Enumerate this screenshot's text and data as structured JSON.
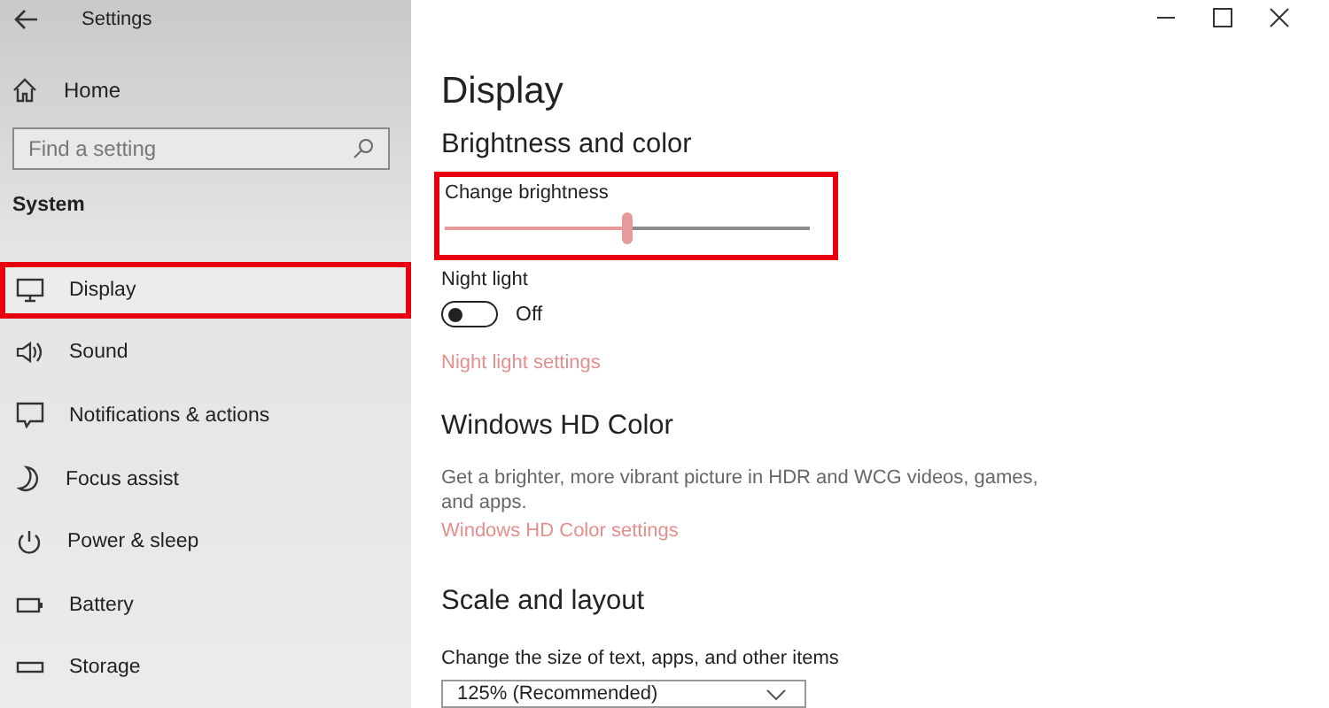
{
  "window": {
    "title": "Settings"
  },
  "sidebar": {
    "home": "Home",
    "search": {
      "placeholder": "Find a setting"
    },
    "section": "System",
    "items": [
      {
        "label": "Display",
        "highlighted": true
      },
      {
        "label": "Sound",
        "highlighted": false
      },
      {
        "label": "Notifications & actions",
        "highlighted": false
      },
      {
        "label": "Focus assist",
        "highlighted": false
      },
      {
        "label": "Power & sleep",
        "highlighted": false
      },
      {
        "label": "Battery",
        "highlighted": false
      },
      {
        "label": "Storage",
        "highlighted": false
      }
    ]
  },
  "page": {
    "title": "Display",
    "brightness_section": {
      "heading": "Brightness and color",
      "slider_label": "Change brightness",
      "level": 0.5,
      "highlighted": true
    },
    "night_light": {
      "label": "Night light",
      "on": false,
      "state_text": "Off",
      "link": "Night light settings"
    },
    "hd_color": {
      "heading": "Windows HD Color",
      "description": "Get a brighter, more vibrant picture in HDR and WCG videos, games, and apps.",
      "link": "Windows HD Color settings"
    },
    "scale": {
      "heading": "Scale and layout",
      "label": "Change the size of text, apps, and other items",
      "value": "125% (Recommended)"
    }
  }
}
